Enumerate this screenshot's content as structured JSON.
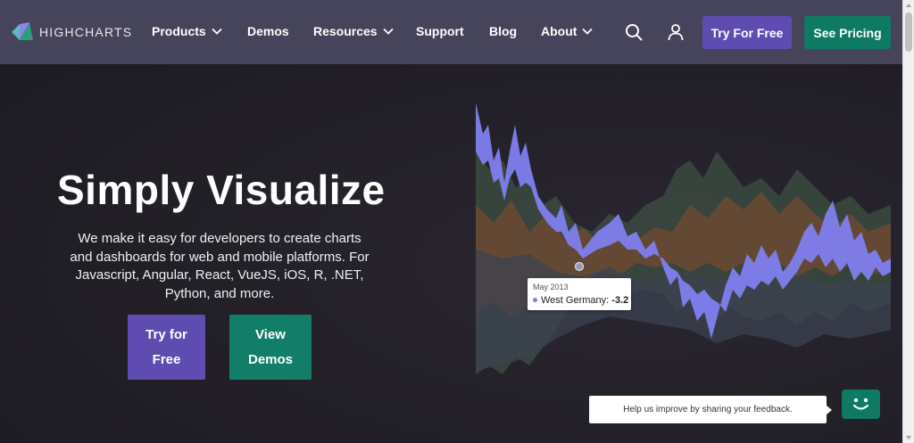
{
  "header": {
    "logo_text": "HIGHCHARTS",
    "nav": [
      {
        "label": "Products",
        "dropdown": true
      },
      {
        "label": "Demos",
        "dropdown": false
      },
      {
        "label": "Resources",
        "dropdown": true
      },
      {
        "label": "Support",
        "dropdown": false
      },
      {
        "label": "Blog",
        "dropdown": false
      },
      {
        "label": "About",
        "dropdown": true
      }
    ],
    "search_icon": "search-icon",
    "user_icon": "user-icon",
    "try_label": "Try For Free",
    "pricing_label": "See Pricing"
  },
  "hero": {
    "title": "Simply Visualize",
    "description": "We make it easy for developers to create charts and dashboards for web and mobile platforms. For Javascript, Angular, React, VueJS, iOS, R, .NET, Python, and more.",
    "btn_try": "Try for Free",
    "btn_demos": "View Demos"
  },
  "tooltip": {
    "date": "May 2013",
    "series": "West Germany:",
    "value": "-3.2"
  },
  "feedback": {
    "text": "Help us improve by sharing your feedback."
  },
  "colors": {
    "header_bg": "#46445a",
    "accent_purple": "#5f4cb0",
    "accent_green": "#0e7a64",
    "series_purple": "#8080ee"
  }
}
